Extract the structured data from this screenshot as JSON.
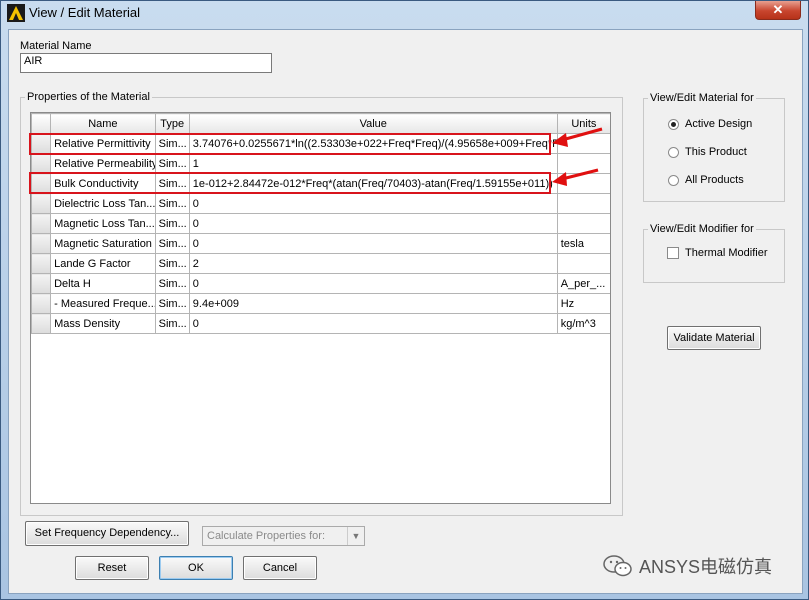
{
  "window": {
    "title": "View / Edit Material",
    "close_glyph": "✕"
  },
  "material": {
    "name_label": "Material Name",
    "name_value": "AIR"
  },
  "properties": {
    "group_label": "Properties of the Material",
    "columns": [
      "Name",
      "Type",
      "Value",
      "Units"
    ],
    "rows": [
      {
        "name": "Relative Permittivity",
        "type": "Sim...",
        "value": "3.74076+0.0255671*ln((2.53303e+022+Freq*Freq)/(4.95658e+009+Freq*F...",
        "units": ""
      },
      {
        "name": "Relative Permeability",
        "type": "Sim...",
        "value": "1",
        "units": ""
      },
      {
        "name": "Bulk Conductivity",
        "type": "Sim...",
        "value": "1e-012+2.84472e-012*Freq*(atan(Freq/70403)-atan(Freq/1.59155e+011))",
        "units": ""
      },
      {
        "name": "Dielectric Loss Tan...",
        "type": "Sim...",
        "value": "0",
        "units": ""
      },
      {
        "name": "Magnetic Loss Tan...",
        "type": "Sim...",
        "value": "0",
        "units": ""
      },
      {
        "name": "Magnetic Saturation",
        "type": "Sim...",
        "value": "0",
        "units": "tesla"
      },
      {
        "name": "Lande G Factor",
        "type": "Sim...",
        "value": "2",
        "units": ""
      },
      {
        "name": "Delta H",
        "type": "Sim...",
        "value": "0",
        "units": "A_per_..."
      },
      {
        "name": "- Measured Freque...",
        "type": "Sim...",
        "value": "9.4e+009",
        "units": "Hz"
      },
      {
        "name": "Mass Density",
        "type": "Sim...",
        "value": "0",
        "units": "kg/m^3"
      }
    ]
  },
  "view_edit_for": {
    "label": "View/Edit Material for",
    "options": [
      "Active Design",
      "This Product",
      "All Products"
    ],
    "selected": "Active Design"
  },
  "modifier": {
    "label": "View/Edit Modifier for",
    "thermal": "Thermal Modifier",
    "thermal_checked": false
  },
  "buttons": {
    "validate": "Validate Material",
    "set_freq": "Set Frequency Dependency...",
    "reset": "Reset",
    "ok": "OK",
    "cancel": "Cancel"
  },
  "calc_combo": {
    "placeholder": "Calculate Properties for:"
  },
  "watermark": {
    "text": "ANSYS电磁仿真",
    "icon": "wechat-icon"
  },
  "colors": {
    "highlight": "#d8141c",
    "arrow": "#e01010"
  }
}
